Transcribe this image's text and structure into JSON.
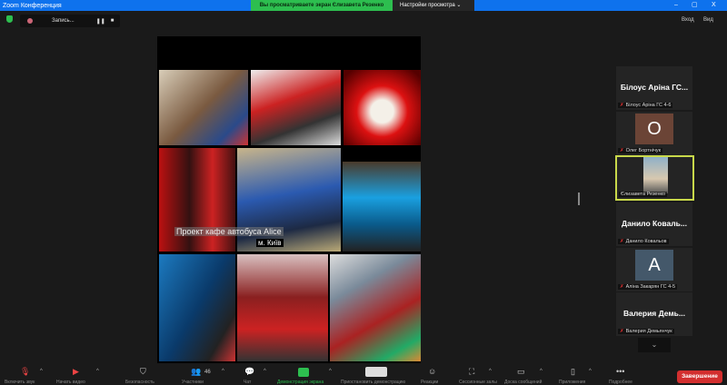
{
  "window": {
    "title": "Zoom Конференция",
    "minimize": "–",
    "maximize": "▢",
    "close": "X"
  },
  "banner": {
    "text": "Вы просматриваете экран Єлизавета Резенко",
    "view_options": "Настройки просмотра ⌄"
  },
  "recording": {
    "label": "Запись...",
    "pause": "❚❚",
    "stop": "■"
  },
  "topright": {
    "enter": "Вход",
    "view": "Вид"
  },
  "slide": {
    "caption": "Проект кафе автобуса Alice",
    "city": "м. Київ"
  },
  "participants": [
    {
      "display": "Білоус  Аріна ГС...",
      "name": "Білоус Аріна ГС 4-6",
      "muted": true
    },
    {
      "avatar": "О",
      "name": "Олег Бортнічук",
      "muted": true,
      "color": "#6b4436"
    },
    {
      "name": "Єлизавета Резенко",
      "video": true,
      "active": true
    },
    {
      "display": "Данило  Коваль...",
      "name": "Данило Ковальов",
      "muted": true
    },
    {
      "avatar": "А",
      "name": "Аліна Закарян ГС 4-5",
      "muted": true,
      "color": "#44586a"
    },
    {
      "display": "Валерия  Демь...",
      "name": "Валерия Демьянчук",
      "muted": true
    }
  ],
  "toolbar": {
    "mute": "Включить звук",
    "video": "Начать видео",
    "security": "Безопасность",
    "participants": "Участники",
    "participants_count": "46",
    "chat": "Чат",
    "share": "Демонстрация экрана",
    "pause": "Приостановить демонстрацию",
    "reactions": "Реакции",
    "rooms": "Сессионные залы",
    "whiteboard": "Доска сообщений",
    "apps": "Приложения",
    "more": "Подробнее",
    "end": "Завершение"
  }
}
